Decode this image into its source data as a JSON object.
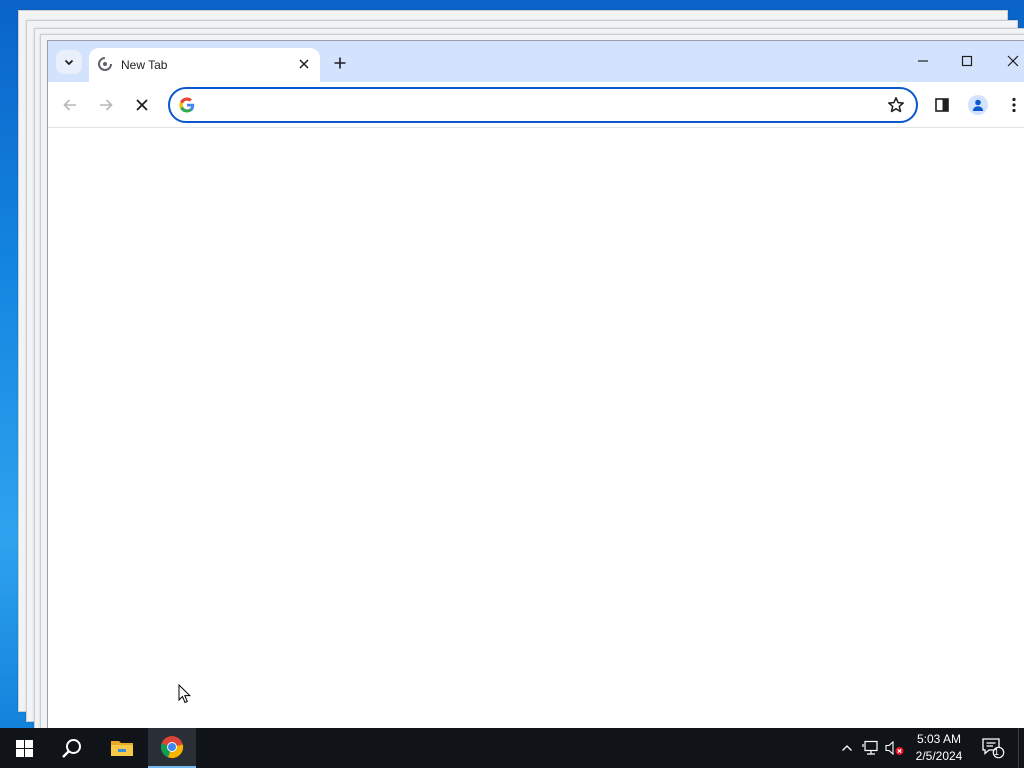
{
  "browser": {
    "tab": {
      "title": "New Tab"
    },
    "omnibox": {
      "value": "",
      "placeholder": ""
    }
  },
  "taskbar": {
    "clock": {
      "time": "5:03 AM",
      "date": "2/5/2024"
    },
    "notification_count": "1"
  },
  "icons": {
    "tab_search": "chevron-down-icon",
    "favicon": "loading-spinner-icon",
    "tab_close": "close-icon",
    "new_tab": "plus-icon",
    "back": "arrow-left-icon",
    "forward": "arrow-right-icon",
    "stop": "close-icon",
    "omnibox": "google-g-icon",
    "bookmark": "star-outline-icon",
    "side_panel": "side-panel-icon",
    "profile": "person-icon",
    "menu": "three-dot-vertical-icon"
  },
  "colors": {
    "accent": "#0b57d0",
    "titlebar": "#d3e3fd",
    "taskbar": "#101419"
  }
}
